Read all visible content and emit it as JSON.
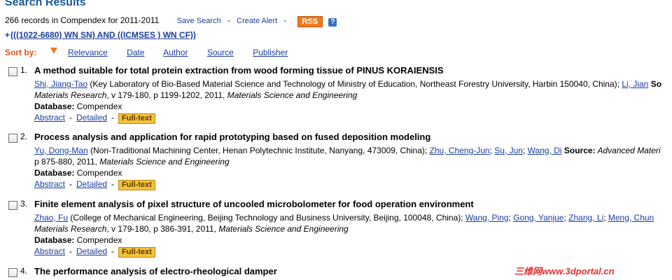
{
  "page": {
    "title": "Search Results"
  },
  "summary": {
    "count_text": "266 records in Compendex for 2011-2011",
    "save_search": "Save Search",
    "separator": "-",
    "create_alert": "Create Alert",
    "separator2": "-",
    "rss": "RSS",
    "help": "?"
  },
  "query": {
    "plus": "+",
    "text": "(((1022-6680) WN SN) AND ((ICMSES ) WN CF))"
  },
  "sort": {
    "label": "Sort by:",
    "options": [
      "Relevance",
      "Date",
      "Author",
      "Source",
      "Publisher"
    ]
  },
  "records": [
    {
      "num": "1.",
      "title": "A method suitable for total protein extraction from wood forming tissue of PINUS KORAIENSIS",
      "authors": [
        {
          "name": "Shi, Jiang-Tao",
          "affil": " (Key Laboratory of Bio-Based Material Science and Technology of Ministry of Education, Northeast Forestry University, Harbin 150040, China); "
        },
        {
          "name": "Li, Jian",
          "affil": " "
        }
      ],
      "source_label": "So",
      "source_text": "",
      "line2_italic": "Materials Research",
      "line2_plain": ", v 179-180, p 1199-1202, 2011, ",
      "line2_italic2": "Materials Science and Engineering",
      "db_label": "Database:",
      "db_value": "Compendex",
      "abstract": "Abstract",
      "detailed": "Detailed",
      "sep": "-",
      "fulltext": "Full-text"
    },
    {
      "num": "2.",
      "title": "Process analysis and application for rapid prototyping based on fused deposition modeling",
      "authors": [
        {
          "name": "Yu, Dong-Man",
          "affil": " (Non-Traditional Machining Center, Henan Polytechnic Institute, Nanyang, 473009, China); "
        },
        {
          "name": "Zhu, Cheng-Jun",
          "affil": "; "
        },
        {
          "name": "Su, Jun",
          "affil": "; "
        },
        {
          "name": "Wang, Di",
          "affil": " "
        }
      ],
      "source_label": "Source:",
      "source_text": " Advanced Materi",
      "line2_italic": "",
      "line2_plain": "p 875-880, 2011, ",
      "line2_italic2": "Materials Science and Engineering",
      "db_label": "Database:",
      "db_value": "Compendex",
      "abstract": "Abstract",
      "detailed": "Detailed",
      "sep": "-",
      "fulltext": "Full-text"
    },
    {
      "num": "3.",
      "title": "Finite element analysis of pixel structure of uncooled microbolometer for food operation environment",
      "authors": [
        {
          "name": "Zhao, Fu",
          "affil": " (College of Mechanical Engineering, Beijing Technology and Business University, Beijing, 100048, China); "
        },
        {
          "name": "Wang, Ping",
          "affil": "; "
        },
        {
          "name": "Gong, Yanjue",
          "affil": "; "
        },
        {
          "name": "Zhang, Li",
          "affil": "; "
        },
        {
          "name": "Meng, Chun",
          "affil": ""
        }
      ],
      "source_label": "",
      "source_text": "",
      "line2_italic": "Materials Research",
      "line2_plain": ", v 179-180, p 386-391, 2011, ",
      "line2_italic2": "Materials Science and Engineering",
      "db_label": "Database:",
      "db_value": "Compendex",
      "abstract": "Abstract",
      "detailed": "Detailed",
      "sep": "-",
      "fulltext": "Full-text"
    },
    {
      "num": "4.",
      "title": "The performance analysis of electro-rheological damper"
    }
  ],
  "watermark": "三维网www.3dportal.cn"
}
